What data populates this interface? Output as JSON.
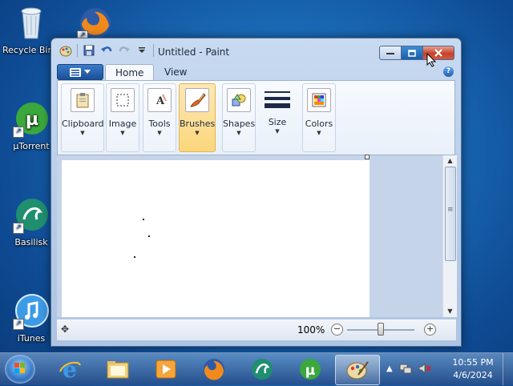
{
  "desktop": {
    "icons": [
      {
        "label": "Recycle Bin"
      },
      {
        "label": ""
      },
      {
        "label": "µTorrent"
      },
      {
        "label": "Basilisk"
      },
      {
        "label": "iTunes"
      }
    ]
  },
  "window": {
    "title": "Untitled - Paint",
    "tabs": {
      "home": "Home",
      "view": "View"
    },
    "groups": {
      "clipboard": "Clipboard",
      "image": "Image",
      "tools": "Tools",
      "brushes": "Brushes",
      "shapes": "Shapes",
      "size": "Size",
      "colors": "Colors"
    },
    "help_glyph": "?",
    "status": {
      "zoom": "100%",
      "zoom_fraction": 0.5
    }
  },
  "taskbar": {
    "time": "10:55 PM",
    "date": "4/6/2024"
  },
  "colors": {
    "accent": "#1b6cb8",
    "close_button": "#c5422a",
    "brushes_highlight": "#fbd67c"
  }
}
